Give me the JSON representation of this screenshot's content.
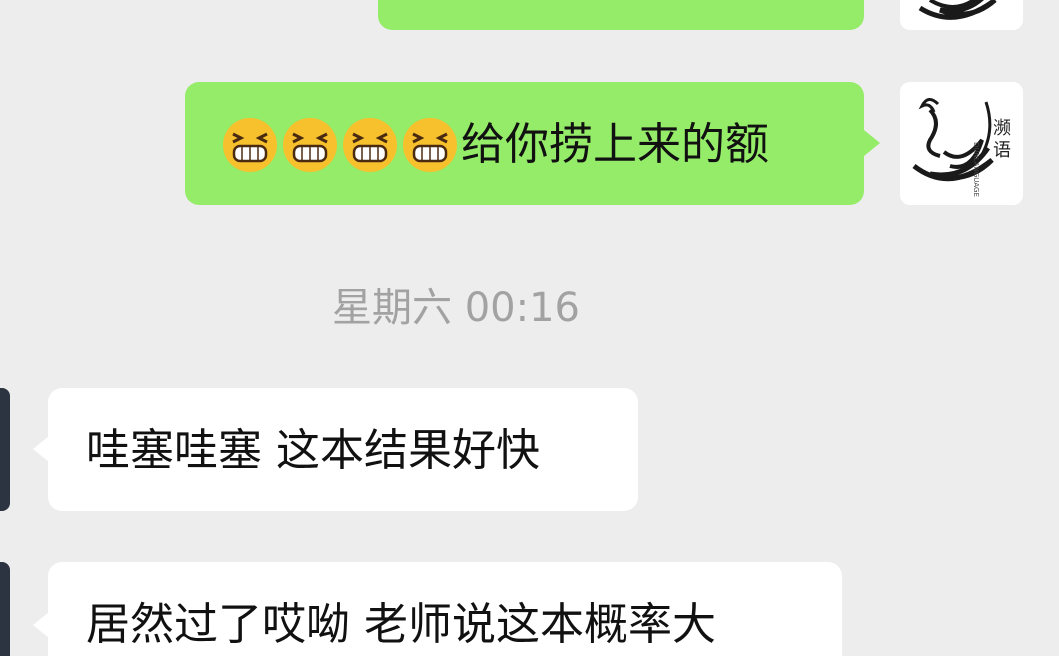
{
  "conversation": {
    "timestamp": "星期六 00:16",
    "messages": [
      {
        "direction": "sent",
        "emoji": [
          "grinning-squinting-face",
          "grinning-squinting-face",
          "grinning-squinting-face",
          "grinning-squinting-face"
        ],
        "text": "给你捞上来的额"
      },
      {
        "direction": "received",
        "text": "哇塞哇塞 这本结果好快"
      },
      {
        "direction": "received",
        "text": "居然过了哎呦 老师说这本概率大"
      }
    ]
  },
  "self_avatar": {
    "label": "濒语"
  },
  "colors": {
    "background": "#ededed",
    "sent_bubble": "#95ec69",
    "received_bubble": "#ffffff",
    "timestamp": "#a2a2a2"
  }
}
